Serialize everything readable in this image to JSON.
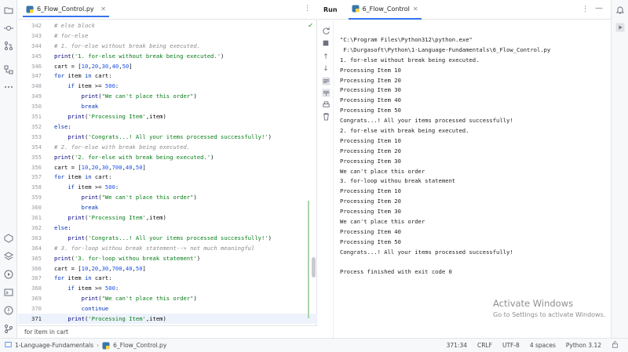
{
  "editor": {
    "tab_label": "6_Flow_Control.py",
    "lines": [
      {
        "n": "342",
        "text": "# else block"
      },
      {
        "n": "343",
        "text": "# for-else"
      },
      {
        "n": "344",
        "text": "# 1. for-else without break being executed."
      },
      {
        "n": "345",
        "text": "print('1. for-else without break being executed.')"
      },
      {
        "n": "346",
        "text": "cart = [10,20,30,40,50]"
      },
      {
        "n": "347",
        "text": "for item in cart:"
      },
      {
        "n": "348",
        "text": "    if item >= 500:"
      },
      {
        "n": "349",
        "text": "        print(\"We can't place this order\")"
      },
      {
        "n": "350",
        "text": "        break"
      },
      {
        "n": "351",
        "text": "    print('Processing Item',item)"
      },
      {
        "n": "352",
        "text": "else:"
      },
      {
        "n": "353",
        "text": "    print('Congrats...! All your items processed successfully!')"
      },
      {
        "n": "354",
        "text": "# 2. for-else with break being executed."
      },
      {
        "n": "355",
        "text": "print('2. for-else with break being executed.')"
      },
      {
        "n": "356",
        "text": "cart = [10,20,30,700,40,50]"
      },
      {
        "n": "357",
        "text": "for item in cart:"
      },
      {
        "n": "358",
        "text": "    if item >= 500:"
      },
      {
        "n": "359",
        "text": "        print(\"We can't place this order\")"
      },
      {
        "n": "360",
        "text": "        break"
      },
      {
        "n": "361",
        "text": "    print('Processing Item',item)"
      },
      {
        "n": "362",
        "text": "else:"
      },
      {
        "n": "363",
        "text": "    print('Congrats...! All your items processed successfully!')"
      },
      {
        "n": "364",
        "text": "# 3. for-loop withou break statement--> not much meaningful"
      },
      {
        "n": "365",
        "text": "print('3. for-loop withou break statement')"
      },
      {
        "n": "366",
        "text": "cart = [10,20,30,700,40,50]"
      },
      {
        "n": "367",
        "text": "for item in cart:"
      },
      {
        "n": "368",
        "text": "    if item >= 500:"
      },
      {
        "n": "369",
        "text": "        print(\"We can't place this order\")"
      },
      {
        "n": "370",
        "text": "        continue"
      },
      {
        "n": "371",
        "text": "    print('Processing Item',item)"
      }
    ],
    "breadcrumb": "for item in cart"
  },
  "run": {
    "label": "Run",
    "tab_label": "6_Flow_Control",
    "console": [
      "\"C:\\Program Files\\Python312\\python.exe\"",
      " F:\\Durgasoft\\Python\\1-Language-Fundamentals\\6_Flow_Control.py",
      "1. for-else without break being executed.",
      "Processing Item 10",
      "Processing Item 20",
      "Processing Item 30",
      "Processing Item 40",
      "Processing Item 50",
      "Congrats...! All your items processed successfully!",
      "2. for-else with break being executed.",
      "Processing Item 10",
      "Processing Item 20",
      "Processing Item 30",
      "We can't place this order",
      "3. for-loop withou break statement",
      "Processing Item 10",
      "Processing Item 20",
      "Processing Item 30",
      "We can't place this order",
      "Processing Item 40",
      "Processing Item 50",
      "Congrats...! All your items processed successfully!",
      "",
      "Process finished with exit code 0"
    ]
  },
  "watermark": {
    "title": "Activate Windows",
    "subtitle": "Go to Settings to activate Windows."
  },
  "status": {
    "crumb_project": "1-Language-Fundamentals",
    "crumb_file": "6_Flow_Control.py",
    "position": "371:34",
    "line_ending": "CRLF",
    "encoding": "UTF-8",
    "indent": "4 spaces",
    "interpreter": "Python 3.12"
  },
  "colors": {
    "accent": "#3574f0",
    "string": "#067d17",
    "keyword": "#0033b3",
    "comment": "#8c8c8c",
    "number": "#1750eb"
  }
}
